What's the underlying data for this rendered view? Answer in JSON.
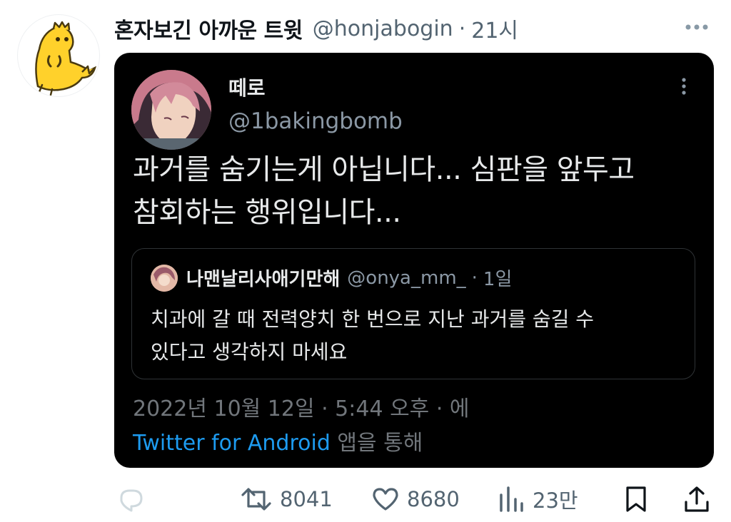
{
  "tweet": {
    "author_name": "혼자보긴 아까운 트윗",
    "author_handle": "@honjabogin",
    "separator": "·",
    "time": "21시",
    "avatar_icon": "yellow-dinosaur-avatar",
    "more_icon": "more-horizontal-icon"
  },
  "quoted": {
    "name": "떼로",
    "handle": "@1bakingbomb",
    "text_line1": "과거를 숨기는게 아닙니다... 심판을 앞두고",
    "text_line2": "참회하는 행위입니다...",
    "timestamp": "2022년 10월 12일 · 5:44 오후 · 에",
    "source_link": "Twitter for Android",
    "source_suffix": " 앱을 통해",
    "inner": {
      "name": "나맨날리사애기만해",
      "handle": "@onya_mm_",
      "separator": "·",
      "time": "1일",
      "text_line1": "치과에 갈 때 전력양치 한 번으로 지난 과거를 숨길 수",
      "text_line2": "있다고 생각하지 마세요"
    }
  },
  "actions": {
    "reply_icon": "reply-icon",
    "retweet_icon": "retweet-icon",
    "retweets": "8041",
    "like_icon": "heart-icon",
    "likes": "8680",
    "views_icon": "views-icon",
    "views": "23만",
    "bookmark_icon": "bookmark-icon",
    "share_icon": "share-icon"
  },
  "colors": {
    "link": "#1d9bf0",
    "muted": "#536471",
    "card_bg": "#000000",
    "avatar_yellow": "#ffd12b"
  }
}
